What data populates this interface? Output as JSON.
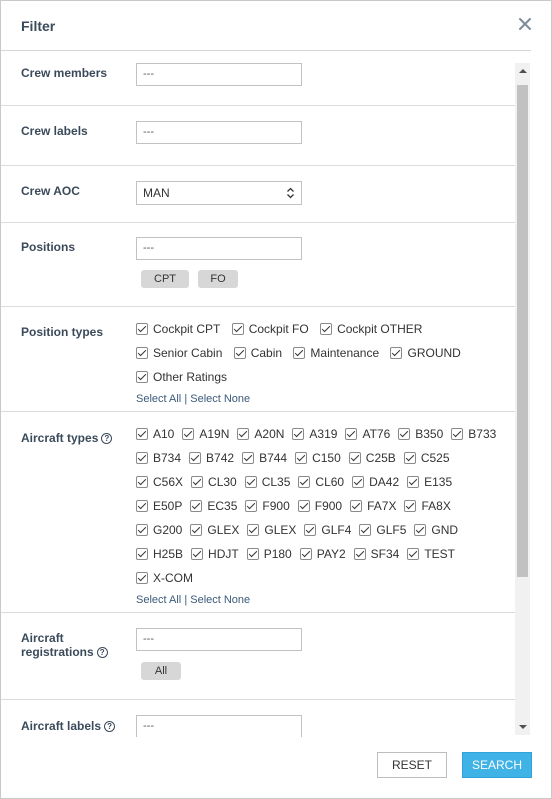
{
  "dialog": {
    "title": "Filter",
    "close_icon": "close-icon"
  },
  "crew_members": {
    "label": "Crew members",
    "value": "---"
  },
  "crew_labels": {
    "label": "Crew labels",
    "value": "---"
  },
  "crew_aoc": {
    "label": "Crew AOC",
    "value": "MAN"
  },
  "positions": {
    "label": "Positions",
    "value": "---",
    "chips": [
      "CPT",
      "FO"
    ]
  },
  "position_types": {
    "label": "Position types",
    "items": [
      "Cockpit CPT",
      "Cockpit FO",
      "Cockpit OTHER",
      "Senior Cabin",
      "Cabin",
      "Maintenance",
      "GROUND",
      "Other Ratings"
    ],
    "select_all": "Select All",
    "separator": "|",
    "select_none": "Select None"
  },
  "aircraft_types": {
    "label": "Aircraft types",
    "help_icon": "help-icon",
    "items": [
      "A10",
      "A19N",
      "A20N",
      "A319",
      "AT76",
      "B350",
      "B733",
      "B734",
      "B742",
      "B744",
      "C150",
      "C25B",
      "C525",
      "C56X",
      "CL30",
      "CL35",
      "CL60",
      "DA42",
      "E135",
      "E50P",
      "EC35",
      "F900",
      "F900",
      "FA7X",
      "FA8X",
      "G200",
      "GLEX",
      "GLEX",
      "GLF4",
      "GLF5",
      "GND",
      "H25B",
      "HDJT",
      "P180",
      "PAY2",
      "SF34",
      "TEST",
      "X-COM"
    ],
    "select_all": "Select All",
    "separator": "|",
    "select_none": "Select None"
  },
  "aircraft_registrations": {
    "label_line1": "Aircraft",
    "label_line2": "registrations",
    "value": "---",
    "chip": "All"
  },
  "aircraft_labels": {
    "label": "Aircraft labels",
    "value": "---"
  },
  "footer": {
    "reset_label": "RESET",
    "search_label": "SEARCH"
  },
  "colors": {
    "accent": "#3fb3e6",
    "title": "#3b4a5a",
    "chip_bg": "#d7d7d7"
  }
}
